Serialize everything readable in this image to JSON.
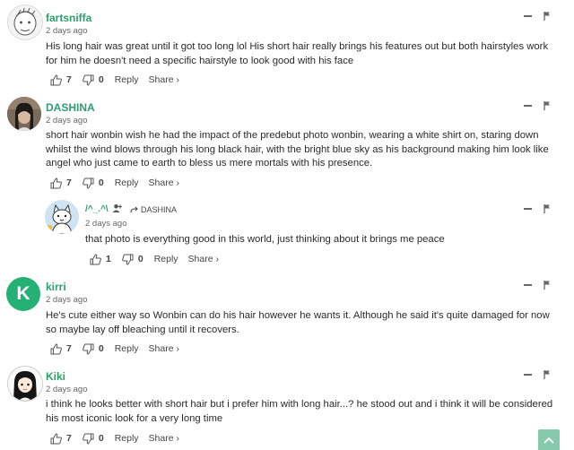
{
  "colors": {
    "username": "#2e9e6f",
    "avatar_green": "#25b175",
    "scroll_button": "#87c9ac"
  },
  "comments": [
    {
      "username": "fartsniffa",
      "time": "2 days ago",
      "text": "His long hair was great until it got too long lol His short hair really brings his features out but both hairstyles work for him he doesn't need a specific hairstyle to look good with his face",
      "upvotes": "7",
      "downvotes": "0",
      "reply_label": "Reply",
      "share_label": "Share ›",
      "avatar": "sketch-face-avatar"
    },
    {
      "username": "DASHINA",
      "time": "2 days ago",
      "text": "short hair wonbin wish he had the impact of the predebut photo wonbin, wearing a white shirt on, staring down whilst the wind blows through his long black hair, with the bright blue sky as his background making him look like angel who just came to earth to bless us mere mortals with his presence.",
      "upvotes": "7",
      "downvotes": "0",
      "reply_label": "Reply",
      "share_label": "Share ›",
      "avatar": "photo-avatar"
    },
    {
      "username": "/^_.^\\",
      "reply_to": "DASHINA",
      "time": "2 days ago",
      "text": "that photo is everything good in this world, just thinking about it brings me peace",
      "upvotes": "1",
      "downvotes": "0",
      "reply_label": "Reply",
      "share_label": "Share ›",
      "avatar": "cat-cartoon-avatar"
    },
    {
      "username": "kirri",
      "time": "2 days ago",
      "text": "He's cute either way so Wonbin can do his hair however he wants it. Although he said it's quite damaged for now so maybe lay off bleaching until it recovers.",
      "upvotes": "7",
      "downvotes": "0",
      "reply_label": "Reply",
      "share_label": "Share ›",
      "avatar_letter": "K"
    },
    {
      "username": "Kiki",
      "time": "2 days ago",
      "text": "i think he looks better with short hair but i prefer him with long hair...? he stood out and i think it will be considered his most iconic look for a very long time",
      "upvotes": "7",
      "downvotes": "0",
      "reply_label": "Reply",
      "share_label": "Share ›",
      "avatar": "anime-girl-avatar"
    }
  ]
}
